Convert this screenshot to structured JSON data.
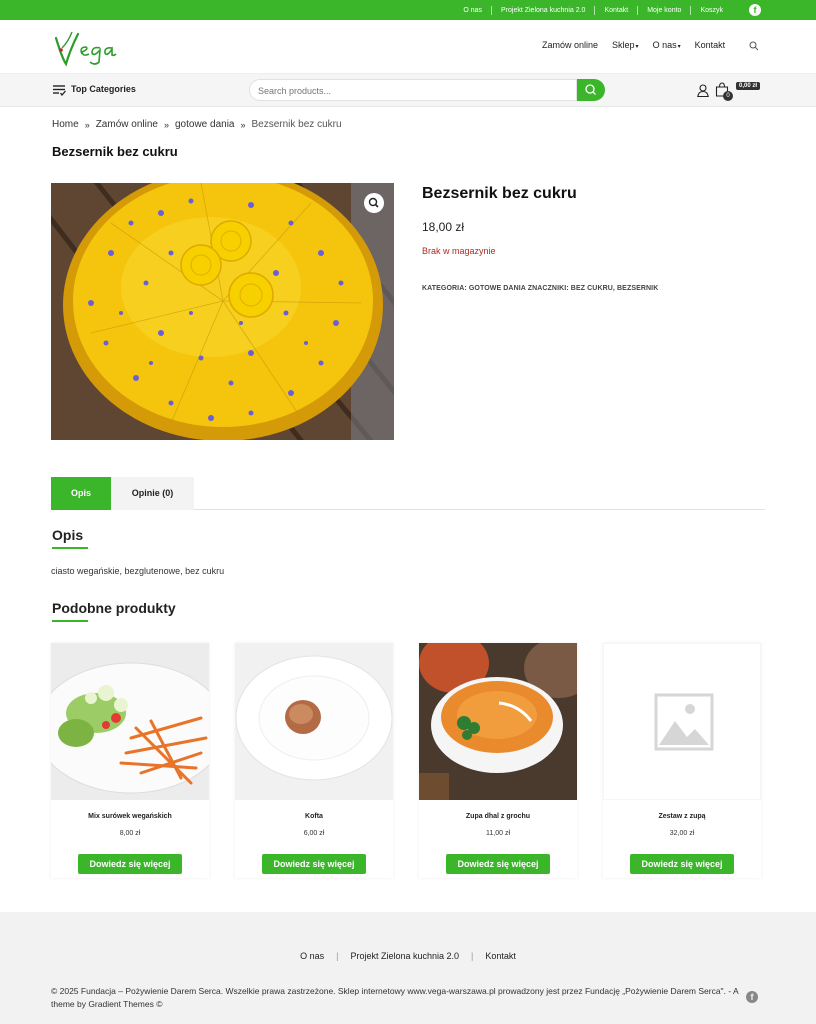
{
  "topbar": {
    "links": [
      "O nas",
      "Projekt Zielona kuchnia 2.0",
      "Kontakt",
      "Moje konto",
      "Koszyk"
    ],
    "social_icon": "facebook-icon"
  },
  "header": {
    "logo_text": "Vega",
    "nav": [
      "Zamów online",
      "Sklep",
      "O nas",
      "Kontakt"
    ],
    "search_icon": "search-icon"
  },
  "catbar": {
    "label": "Top Categories",
    "search_placeholder": "Search products...",
    "cart_count": "0",
    "cart_total": "0,00 zł"
  },
  "breadcrumb": [
    "Home",
    "Zamów online",
    "gotowe dania",
    "Bezsernik bez cukru"
  ],
  "page_title": "Bezsernik bez cukru",
  "product": {
    "title": "Bezsernik bez cukru",
    "price": "18,00 zł",
    "stock": "Brak w magazynie",
    "meta": "KATEGORIA: GOTOWE DANIA ZNACZNIKI: BEZ CUKRU, BEZSERNIK"
  },
  "tabs": [
    "Opis",
    "Opinie (0)"
  ],
  "description": {
    "heading": "Opis",
    "text": "ciasto wegańskie, bezglutenowe, bez cukru"
  },
  "related": {
    "heading": "Podobne produkty",
    "items": [
      {
        "name": "Mix surówek wegańskich",
        "price": "8,00 zł",
        "button": "Dowiedz się więcej"
      },
      {
        "name": "Kofta",
        "price": "6,00 zł",
        "button": "Dowiedz się więcej"
      },
      {
        "name": "Zupa dhal z grochu",
        "price": "11,00 zł",
        "button": "Dowiedz się więcej"
      },
      {
        "name": "Zestaw z zupą",
        "price": "32,00 zł",
        "button": "Dowiedz się więcej"
      }
    ]
  },
  "footer": {
    "nav": [
      "O nas",
      "Projekt Zielona kuchnia 2.0",
      "Kontakt"
    ],
    "copyright": "© 2025 Fundacja – Pożywienie Darem Serca. Wszelkie prawa zastrzeżone. Sklep internetowy www.vega-warszawa.pl prowadzony jest przez Fundację „Pożywienie Darem Serca\". - A theme by Gradient Themes ©"
  },
  "colors": {
    "accent": "#3bb52a",
    "stock_red": "#b22a1e",
    "footer_bg": "#f2f2f2"
  }
}
